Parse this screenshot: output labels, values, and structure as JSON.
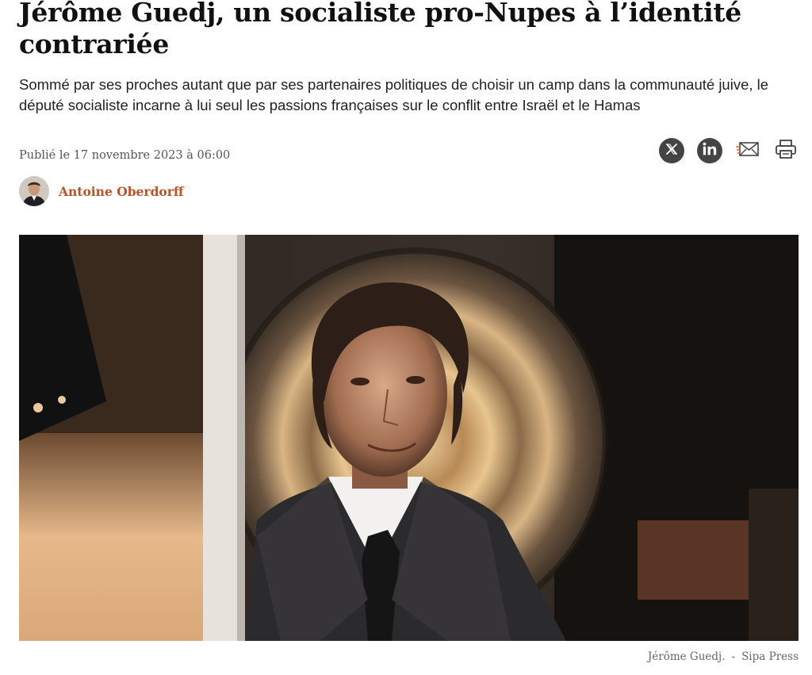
{
  "article": {
    "title": "Jérôme Guedj, un socialiste pro-Nupes à l’identité contrariée",
    "lede": "Sommé par ses proches autant que par ses partenaires politiques de choisir un camp dans la communauté juive, le député socialiste incarne à lui seul les passions françaises sur le conflit entre Israël et le Hamas",
    "published": "Publié le 17 novembre 2023 à 06:00",
    "author": "Antoine Oberdorff"
  },
  "share": {
    "icons": [
      "x-icon",
      "linkedin-icon",
      "email-icon",
      "print-icon"
    ]
  },
  "photo": {
    "caption_name": "Jérôme Guedj.",
    "caption_separator": "-",
    "caption_credit": "Sipa Press"
  },
  "colors": {
    "author_accent": "#b8532a",
    "icon_dark": "#444444"
  }
}
